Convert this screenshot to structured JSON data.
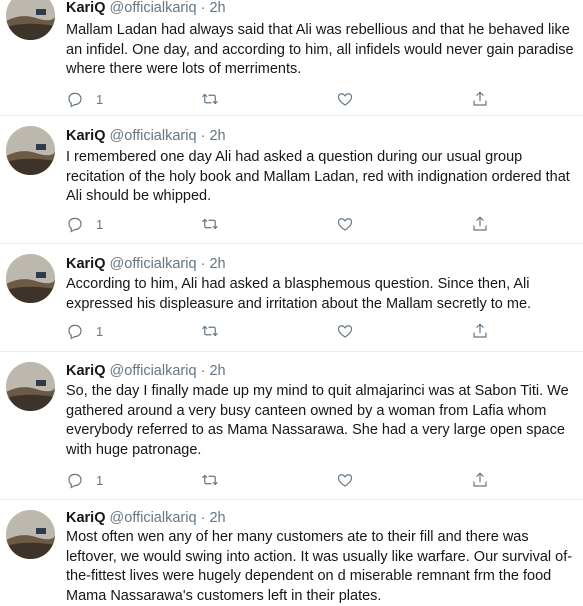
{
  "tweets": [
    {
      "name": "KariQ",
      "handle": "@officialkariq",
      "dot": "·",
      "time": "2h",
      "text": "Mallam Ladan had always said that Ali was rebellious and that he behaved like an infidel. One day, and according to him, all infidels would never gain paradise where there were lots of merriments.",
      "reply_count": "1"
    },
    {
      "name": "KariQ",
      "handle": "@officialkariq",
      "dot": "·",
      "time": "2h",
      "text": "I remembered one day Ali had asked a question during our usual group recitation of the holy book and Mallam Ladan, red with indignation ordered that Ali should be whipped.",
      "reply_count": "1"
    },
    {
      "name": "KariQ",
      "handle": "@officialkariq",
      "dot": "·",
      "time": "2h",
      "text": "According to him, Ali had asked a blasphemous question. Since then, Ali expressed his displeasure and irritation about the Mallam secretly to me.",
      "reply_count": "1"
    },
    {
      "name": "KariQ",
      "handle": "@officialkariq",
      "dot": "·",
      "time": "2h",
      "text": "So, the day I finally made up my mind to quit almajarinci was at Sabon Titi. We gathered around a very busy canteen owned by a woman from Lafia whom everybody referred to as Mama Nassarawa. She had a very large open space with huge patronage.",
      "reply_count": "1"
    },
    {
      "name": "KariQ",
      "handle": "@officialkariq",
      "dot": "·",
      "time": "2h",
      "text": "Most often wen any of her many customers ate to their fill and there was leftover, we would swing into action. It was usually like warfare. Our survival of-the-fittest lives were hugely dependent on d miserable remnant frm the food Mama Nassarawa's customers left in their plates.",
      "reply_count": ""
    }
  ],
  "icons": {
    "reply": "reply-icon",
    "retweet": "retweet-icon",
    "like": "heart-icon",
    "share": "share-icon"
  },
  "colors": {
    "text": "#14171a",
    "secondary": "#657786",
    "divider": "#e6ecf0"
  }
}
